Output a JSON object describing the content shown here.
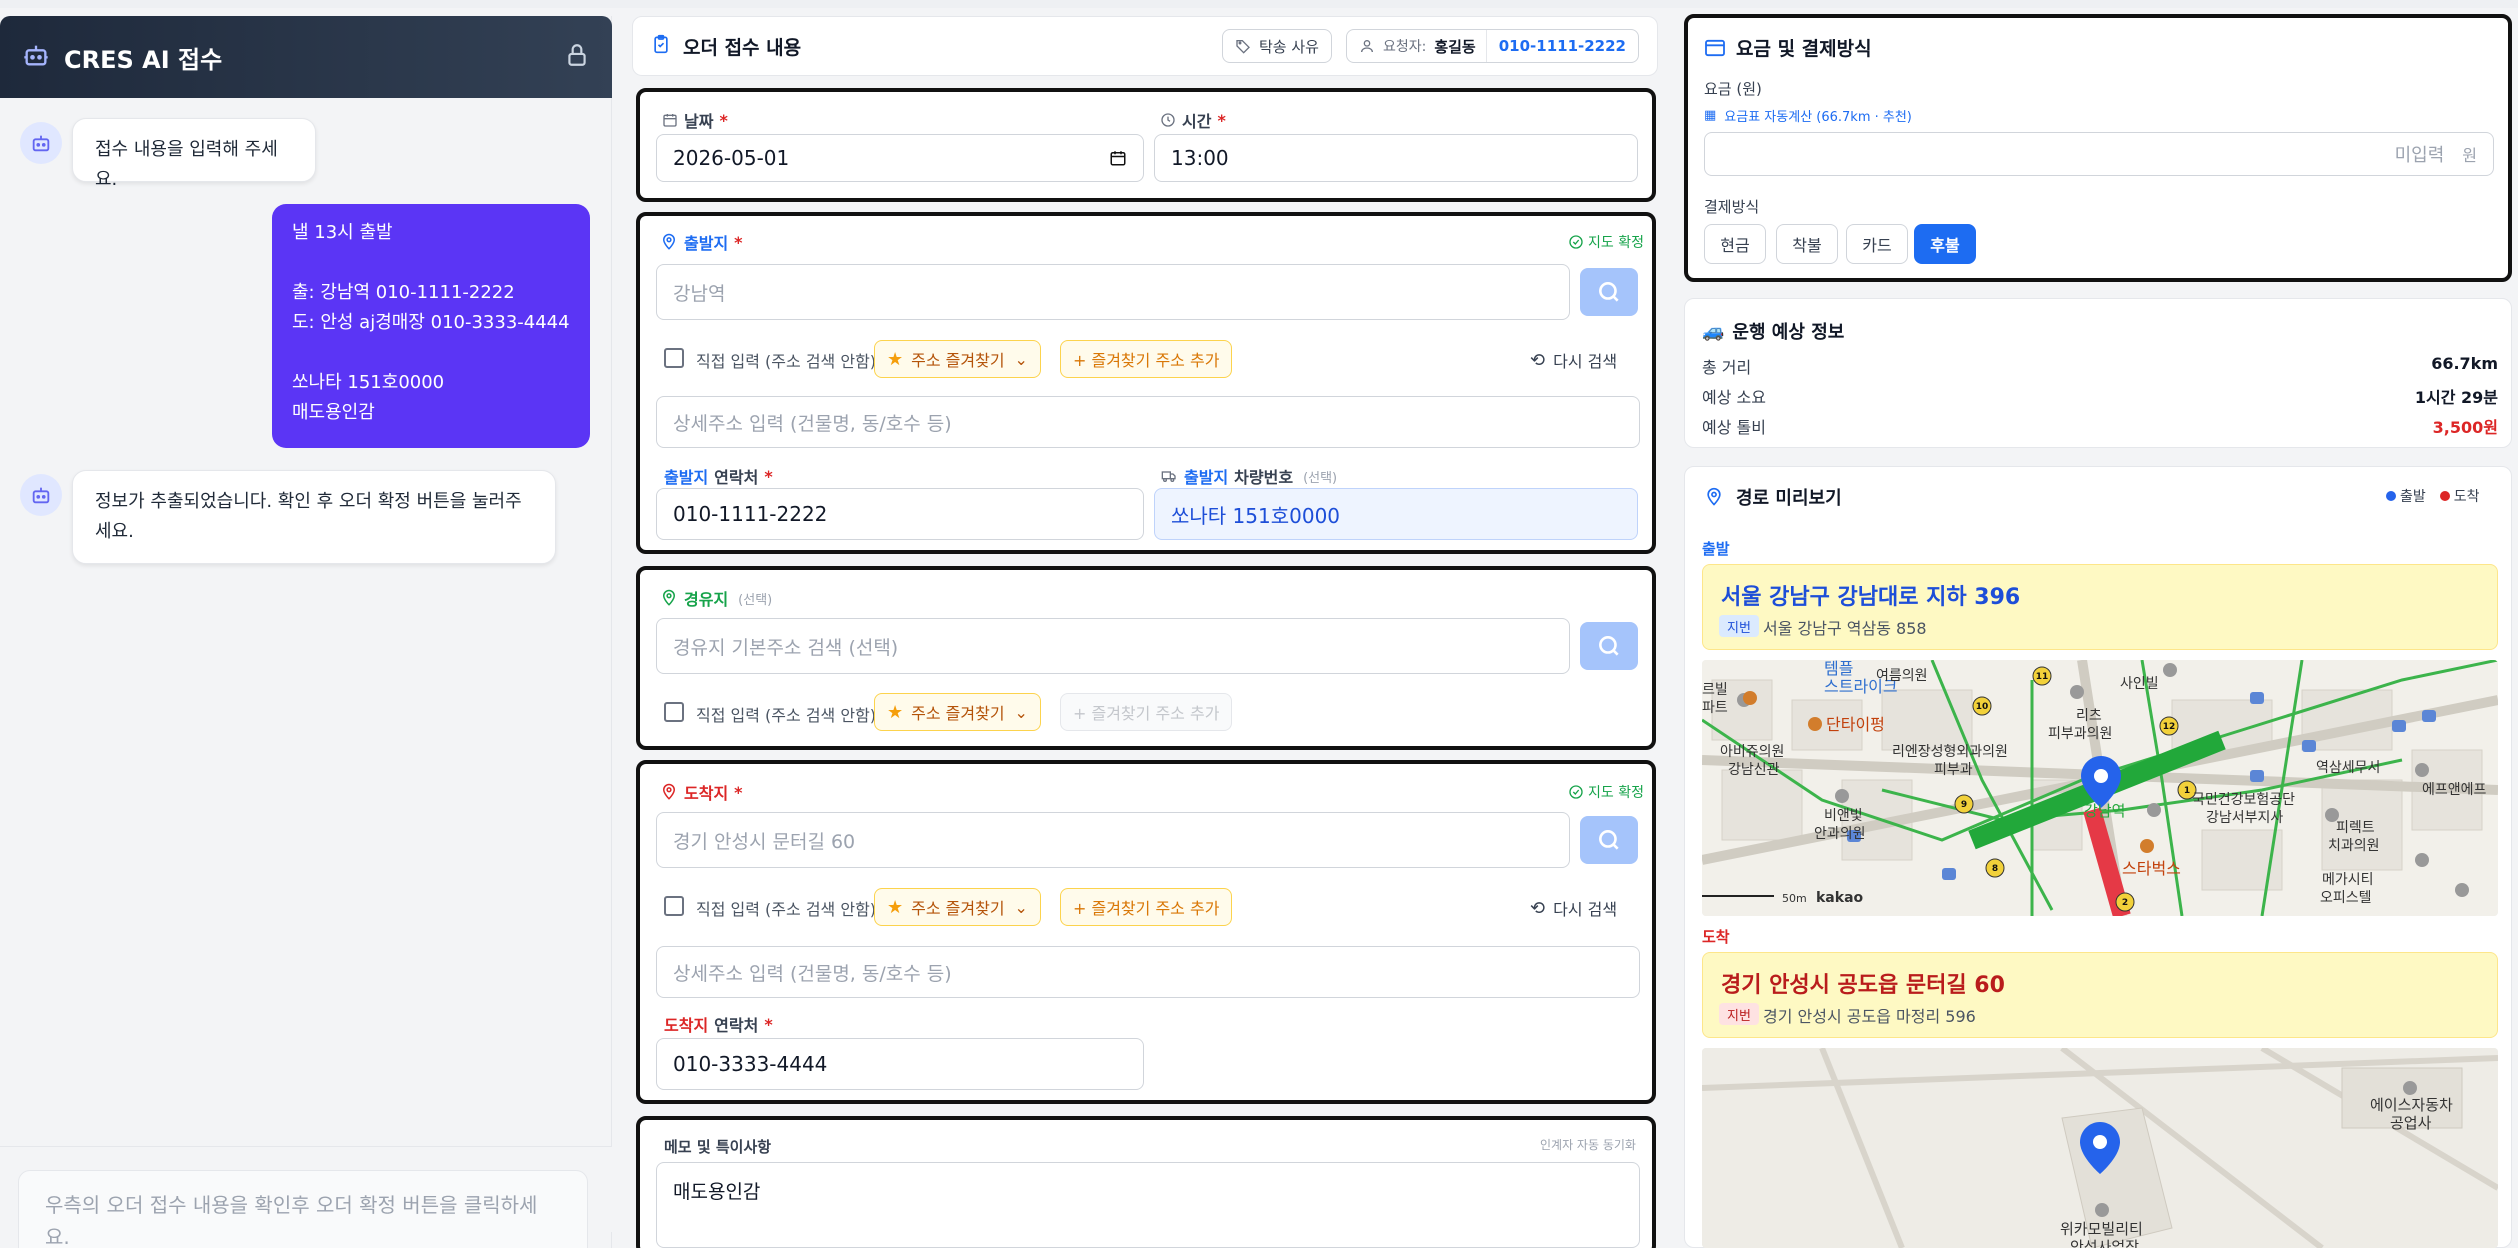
{
  "chat": {
    "title": "CRES AI 접수",
    "messages": [
      {
        "role": "bot",
        "text": "접수 내용을 입력해 주세요."
      },
      {
        "role": "user",
        "text": "낼 13시 출발\n\n출: 강남역 010-1111-2222\n도: 안성 aj경매장 010-3333-4444\n\n쏘나타 151호0000\n매도용인감"
      },
      {
        "role": "bot",
        "text": "정보가 추출되었습니다. 확인 후 오더 확정 버튼을 눌러주세요."
      }
    ],
    "input_placeholder": "우측의 오더 접수 내용을 확인후 오더 확정 버튼을 클릭하세요."
  },
  "order": {
    "title": "오더 접수 내용",
    "reason_chip": "탁송 사유",
    "requester_label": "요청자:",
    "requester_name": "홍길동",
    "requester_phone": "010-1111-2222",
    "date_label": "날짜",
    "date_value": "2026-05-01",
    "time_label": "시간",
    "time_value": "13:00",
    "origin": {
      "label": "출발지",
      "confirmed": "지도 확정",
      "address": "강남역",
      "manual_input": "직접 입력 (주소 검색 안함)",
      "favorites": "주소 즐겨찾기",
      "add_favorite": "+ 즐겨찾기 주소 추가",
      "research": "다시 검색",
      "detail_placeholder": "상세주소 입력 (건물명, 동/호수 등)",
      "contact_label_prefix": "출발지",
      "contact_label": "연락처",
      "contact_value": "010-1111-2222",
      "vehicle_label_prefix": "출발지",
      "vehicle_label": "차량번호",
      "vehicle_optional": "(선택)",
      "vehicle_value": "쏘나타 151호0000"
    },
    "waypoint": {
      "label": "경유지",
      "optional": "(선택)",
      "placeholder": "경유지 기본주소 검색 (선택)",
      "manual_input": "직접 입력 (주소 검색 안함)",
      "favorites": "주소 즐겨찾기",
      "add_favorite": "+ 즐겨찾기 주소 추가"
    },
    "destination": {
      "label": "도착지",
      "confirmed": "지도 확정",
      "address": "경기 안성시 문터길 60",
      "manual_input": "직접 입력 (주소 검색 안함)",
      "favorites": "주소 즐겨찾기",
      "add_favorite": "+ 즐겨찾기 주소 추가",
      "research": "다시 검색",
      "detail_placeholder": "상세주소 입력 (건물명, 동/호수 등)",
      "contact_label_prefix": "도착지",
      "contact_label": "연락처",
      "contact_value": "010-3333-4444"
    },
    "memo": {
      "label": "메모 및 특이사항",
      "sync_note": "인계자 자동 동기화",
      "value": "매도용인감"
    }
  },
  "fare": {
    "title": "요금 및 결제방식",
    "fare_label": "요금 (원)",
    "auto_calc": "요금표 자동계산 (66.7km · 추천)",
    "fare_placeholder": "미입력",
    "unit": "원",
    "payment_label": "결제방식",
    "payment_options": [
      "현금",
      "착불",
      "카드",
      "후불"
    ],
    "payment_selected": "후불"
  },
  "estimate": {
    "title": "운행 예상 정보",
    "distance_label": "총 거리",
    "distance_value": "66.7km",
    "duration_label": "예상 소요",
    "duration_value": "1시간 29분",
    "toll_label": "예상 톨비",
    "toll_value": "3,500원"
  },
  "route": {
    "title": "경로 미리보기",
    "legend_start": "출발",
    "legend_end": "도착",
    "start_label": "출발",
    "start_address": "서울 강남구 강남대로 지하 396",
    "start_lot_tag": "지번",
    "start_lot": "서울 강남구 역삼동 858",
    "end_label": "도착",
    "end_address": "경기 안성시 공도읍 문터길 60",
    "end_lot_tag": "지번",
    "end_lot": "경기 안성시 공도읍 마정리 596",
    "map1_labels": [
      "템플",
      "스트라이크",
      "여름의원",
      "사인빌",
      "르빌",
      "파트",
      "리츠",
      "피부과의원",
      "단타이펑",
      "아비쥬의원",
      "강남신관",
      "리엔장성형외과의원",
      "피부과",
      "역삼세무서",
      "에프앤에프",
      "국민건강보험공단",
      "강남서부지사",
      "피렉트",
      "치과의원",
      "비앤빛",
      "안과의원",
      "강남역",
      "스타벅스",
      "메가시티",
      "오피스텔",
      "50m",
      "kakao"
    ],
    "map2_labels": [
      "에이스자동차",
      "공업사",
      "위카모빌리티",
      "안성사업장"
    ],
    "colors": {
      "start_dot": "#2563eb",
      "end_dot": "#dc2626"
    }
  },
  "colors": {
    "accent": "#1d6cf2",
    "chat_user_bubble": "#5b35f5",
    "chat_header": "#1e293b",
    "required": "#dc2626",
    "confirmed": "#16a34a",
    "toll": "#dc2626"
  }
}
